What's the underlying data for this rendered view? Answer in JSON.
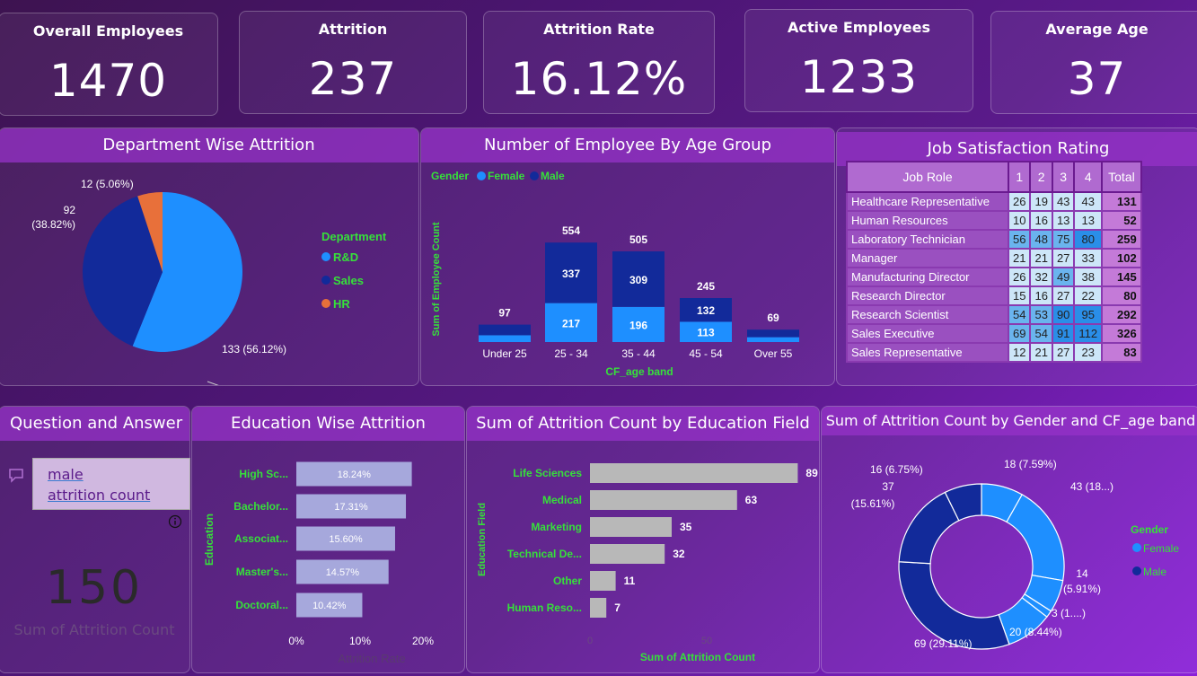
{
  "kpis": [
    {
      "title": "Overall Employees",
      "value": "1470"
    },
    {
      "title": "Attrition",
      "value": "237"
    },
    {
      "title": "Attrition Rate",
      "value": "16.12%"
    },
    {
      "title": "Active Employees",
      "value": "1233"
    },
    {
      "title": "Average Age",
      "value": "37"
    }
  ],
  "dept": {
    "title": "Department Wise Attrition",
    "legend_title": "Department",
    "labels": {
      "rd": "133 (56.12%)",
      "sales_a": "92",
      "sales_b": "(38.82%)",
      "hr": "12 (5.06%)"
    },
    "legend": [
      "R&D",
      "Sales",
      "HR"
    ]
  },
  "age_group": {
    "title": "Number of Employee By Age Group",
    "legend_title": "Gender",
    "legend": [
      "Female",
      "Male"
    ],
    "ylabel": "Sum of Employee Count",
    "xlabel": "CF_age band",
    "categories": [
      "Under 25",
      "25 - 34",
      "35 - 44",
      "45 - 54",
      "Over 55"
    ],
    "totals": [
      "97",
      "554",
      "505",
      "245",
      "69"
    ],
    "female": [
      "",
      "217",
      "196",
      "113",
      ""
    ],
    "male": [
      "",
      "337",
      "309",
      "132",
      ""
    ]
  },
  "job_sat": {
    "title": "Job Satisfaction Rating",
    "headers": [
      "Job Role",
      "1",
      "2",
      "3",
      "4",
      "Total"
    ],
    "rows": [
      [
        "Healthcare Representative",
        "26",
        "19",
        "43",
        "43",
        "131"
      ],
      [
        "Human Resources",
        "10",
        "16",
        "13",
        "13",
        "52"
      ],
      [
        "Laboratory Technician",
        "56",
        "48",
        "75",
        "80",
        "259"
      ],
      [
        "Manager",
        "21",
        "21",
        "27",
        "33",
        "102"
      ],
      [
        "Manufacturing Director",
        "26",
        "32",
        "49",
        "38",
        "145"
      ],
      [
        "Research Director",
        "15",
        "16",
        "27",
        "22",
        "80"
      ],
      [
        "Research Scientist",
        "54",
        "53",
        "90",
        "95",
        "292"
      ],
      [
        "Sales Executive",
        "69",
        "54",
        "91",
        "112",
        "326"
      ],
      [
        "Sales Representative",
        "12",
        "21",
        "27",
        "23",
        "83"
      ]
    ]
  },
  "qa": {
    "title": "Question and Answer",
    "line1": "male",
    "line2": "attrition count",
    "value": "150",
    "caption": "Sum of Attrition Count"
  },
  "edu_attrition": {
    "title": "Education Wise Attrition",
    "ylabel": "Education",
    "xlabel": "Attrition Rate",
    "ticks": [
      "0%",
      "10%",
      "20%"
    ]
  },
  "edu_field": {
    "title": "Sum of Attrition Count by Education Field",
    "ylabel": "Education Field",
    "xlabel": "Sum of Attrition Count",
    "ticks": [
      "0",
      "50"
    ]
  },
  "donut": {
    "title": "Sum of Attrition Count by Gender and CF_age band",
    "legend_title": "Gender",
    "legend": [
      "Female",
      "Male"
    ],
    "labels": {
      "a": "18 (7.59%)",
      "b": "43 (18...)",
      "c1": "14",
      "c2": "(5.91%)",
      "d": "3 (1....)",
      "e": "20 (8.44%)",
      "f": "69 (29.11%)",
      "g1": "37",
      "g2": "(15.61%)",
      "h": "16 (6.75%)"
    }
  },
  "chart_data": [
    {
      "type": "pie",
      "title": "Department Wise Attrition",
      "categories": [
        "R&D",
        "Sales",
        "HR"
      ],
      "values": [
        133,
        92,
        12
      ],
      "percents": [
        56.12,
        38.82,
        5.06
      ],
      "colors": [
        "#1e8fff",
        "#122a9a",
        "#e8703a"
      ],
      "legend": "right"
    },
    {
      "type": "bar",
      "title": "Number of Employee By Age Group",
      "categories": [
        "Under 25",
        "25 - 34",
        "35 - 44",
        "45 - 54",
        "Over 55"
      ],
      "series": [
        {
          "name": "Female",
          "values": [
            38,
            217,
            196,
            113,
            27
          ]
        },
        {
          "name": "Male",
          "values": [
            59,
            337,
            309,
            132,
            42
          ]
        }
      ],
      "totals": [
        97,
        554,
        505,
        245,
        69
      ],
      "xlabel": "CF_age band",
      "ylabel": "Sum of Employee Count",
      "stacked": true,
      "colors": [
        "#1e8fff",
        "#122a9a"
      ]
    },
    {
      "type": "bar",
      "orientation": "horizontal",
      "title": "Education Wise Attrition",
      "categories": [
        "High Sc...",
        "Bachelor...",
        "Associat...",
        "Master's...",
        "Doctoral..."
      ],
      "values": [
        18.24,
        17.31,
        15.6,
        14.57,
        10.42
      ],
      "value_labels": [
        "18.24%",
        "17.31%",
        "15.60%",
        "14.57%",
        "10.42%"
      ],
      "xlabel": "Attrition Rate",
      "ylabel": "Education",
      "xlim": [
        0,
        20
      ],
      "color": "#a6a8dc"
    },
    {
      "type": "bar",
      "orientation": "horizontal",
      "title": "Sum of Attrition Count by Education Field",
      "categories": [
        "Life Sciences",
        "Medical",
        "Marketing",
        "Technical De...",
        "Other",
        "Human Reso..."
      ],
      "values": [
        89,
        63,
        35,
        32,
        11,
        7
      ],
      "xlabel": "Sum of Attrition Count",
      "ylabel": "Education Field",
      "xlim": [
        0,
        100
      ],
      "color": "#b8b8b8"
    },
    {
      "type": "pie",
      "title": "Sum of Attrition Count by Gender and CF_age band",
      "series": [
        {
          "name": "Female",
          "values": [
            18,
            43,
            14,
            3,
            20
          ]
        },
        {
          "name": "Male",
          "values": [
            69,
            37,
            16
          ]
        }
      ],
      "colors": [
        "#1e8fff",
        "#122a9a"
      ],
      "legend": "right"
    }
  ]
}
